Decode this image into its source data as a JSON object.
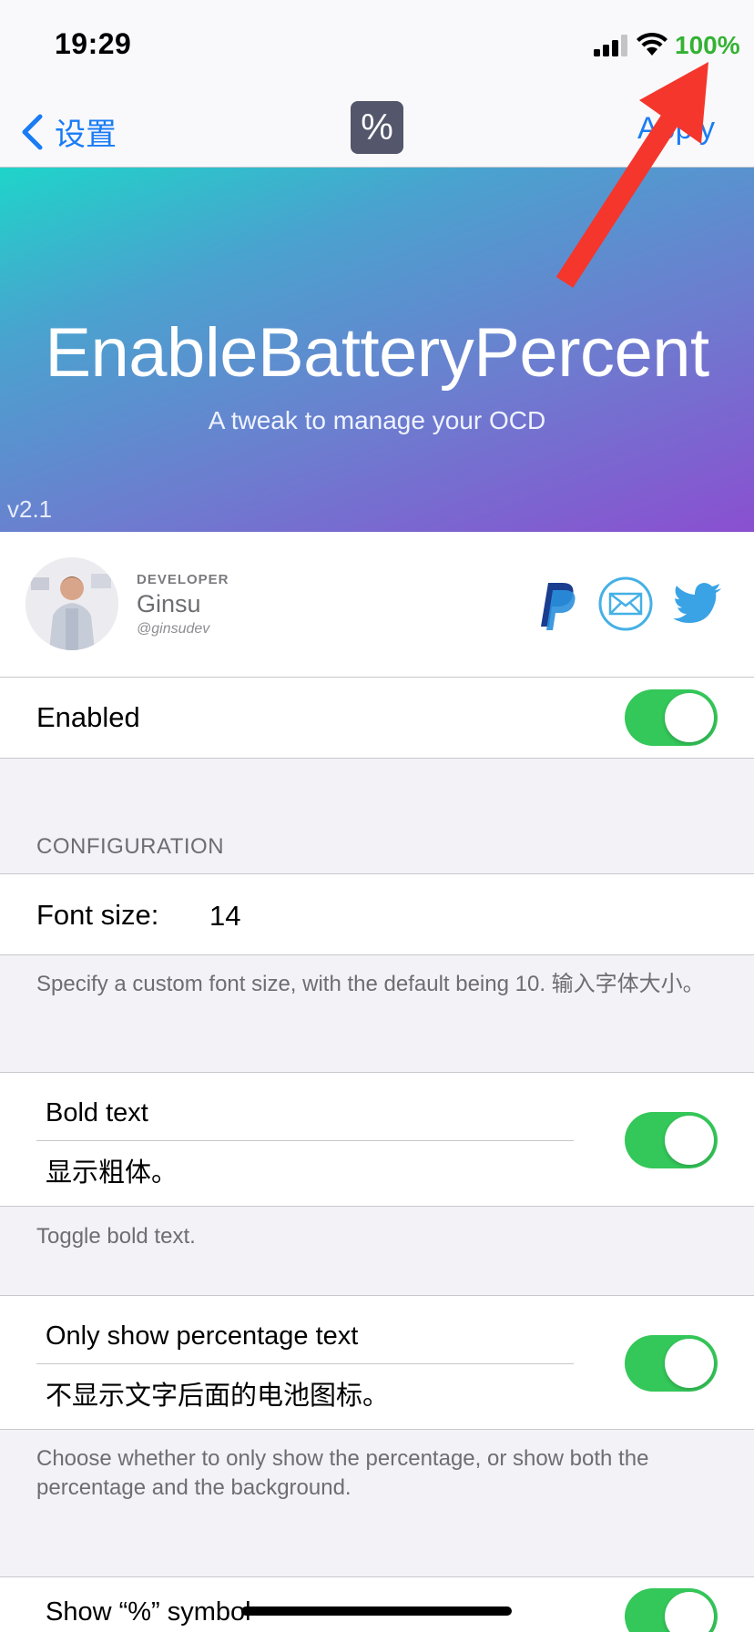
{
  "status": {
    "time": "19:29",
    "battery_percent": "100%"
  },
  "nav": {
    "back_label": "设置",
    "title_icon_glyph": "%",
    "apply_label": "Apply"
  },
  "hero": {
    "title": "EnableBatteryPercent",
    "subtitle": "A tweak to manage your OCD",
    "version": "v2.1"
  },
  "developer": {
    "label": "DEVELOPER",
    "name": "Ginsu",
    "handle": "@ginsudev",
    "links": [
      "paypal-icon",
      "mail-icon",
      "twitter-icon"
    ]
  },
  "enabled": {
    "label": "Enabled",
    "on": true
  },
  "configuration": {
    "header": "CONFIGURATION",
    "font_size": {
      "label": "Font size:",
      "value": "14"
    },
    "font_size_footer": "Specify a custom font size, with the default being 10. 输入字体大小。",
    "bold": {
      "label": "Bold text",
      "sublabel": "显示粗体。",
      "on": true
    },
    "bold_footer": "Toggle bold text.",
    "only_pct": {
      "label": "Only show percentage text",
      "sublabel": "不显示文字后面的电池图标。",
      "on": true
    },
    "only_pct_footer": "Choose whether to only show the percentage, or show both the percentage and the background.",
    "show_symbol": {
      "label": "Show “%” symbol",
      "on": true
    }
  },
  "colors": {
    "accent": "#1a7cf5",
    "toggle_on": "#34c759",
    "battery_green": "#34b233",
    "annotation_arrow": "#f4362c"
  }
}
